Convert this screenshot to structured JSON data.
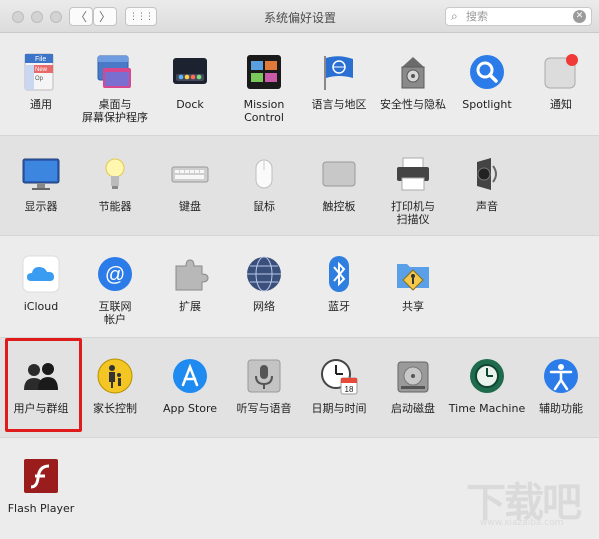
{
  "window": {
    "title": "系统偏好设置",
    "search_placeholder": "搜索",
    "grid_icon": "grid-icon",
    "back_icon": "chevron-left-icon",
    "forward_icon": "chevron-right-icon",
    "back_glyph": "〈",
    "forward_glyph": "〉",
    "grid_glyph": "⋮⋮⋮",
    "search_glyph": "⌕",
    "clear_glyph": "✕"
  },
  "rows": [
    [
      {
        "label": "通用",
        "icon": "general-icon"
      },
      {
        "label": "桌面与\n屏幕保护程序",
        "icon": "desktop-screensaver-icon"
      },
      {
        "label": "Dock",
        "icon": "dock-icon"
      },
      {
        "label": "Mission\nControl",
        "icon": "mission-control-icon"
      },
      {
        "label": "语言与地区",
        "icon": "language-region-icon"
      },
      {
        "label": "安全性与隐私",
        "icon": "security-privacy-icon"
      },
      {
        "label": "Spotlight",
        "icon": "spotlight-icon"
      },
      {
        "label": "通知",
        "icon": "notifications-icon"
      }
    ],
    [
      {
        "label": "显示器",
        "icon": "displays-icon"
      },
      {
        "label": "节能器",
        "icon": "energy-saver-icon"
      },
      {
        "label": "键盘",
        "icon": "keyboard-icon"
      },
      {
        "label": "鼠标",
        "icon": "mouse-icon"
      },
      {
        "label": "触控板",
        "icon": "trackpad-icon"
      },
      {
        "label": "打印机与\n扫描仪",
        "icon": "printers-scanners-icon"
      },
      {
        "label": "声音",
        "icon": "sound-icon"
      }
    ],
    [
      {
        "label": "iCloud",
        "icon": "icloud-icon"
      },
      {
        "label": "互联网\n帐户",
        "icon": "internet-accounts-icon"
      },
      {
        "label": "扩展",
        "icon": "extensions-icon"
      },
      {
        "label": "网络",
        "icon": "network-icon"
      },
      {
        "label": "蓝牙",
        "icon": "bluetooth-icon"
      },
      {
        "label": "共享",
        "icon": "sharing-icon"
      }
    ],
    [
      {
        "label": "用户与群组",
        "icon": "users-groups-icon"
      },
      {
        "label": "家长控制",
        "icon": "parental-controls-icon"
      },
      {
        "label": "App Store",
        "icon": "app-store-icon"
      },
      {
        "label": "听写与语音",
        "icon": "dictation-speech-icon"
      },
      {
        "label": "日期与时间",
        "icon": "date-time-icon"
      },
      {
        "label": "启动磁盘",
        "icon": "startup-disk-icon"
      },
      {
        "label": "Time Machine",
        "icon": "time-machine-icon"
      },
      {
        "label": "辅助功能",
        "icon": "accessibility-icon"
      }
    ],
    [
      {
        "label": "Flash Player",
        "icon": "flash-player-icon"
      }
    ]
  ],
  "general_icon_text": {
    "file": "File",
    "new": "New",
    "op": "Op"
  },
  "date_icon_text": {
    "day": "18"
  },
  "watermark": {
    "text": "下载吧",
    "url": "www.xiazaiba.com"
  },
  "colors": {
    "highlight": "#e01b1b",
    "accent_blue": "#1a7ff0"
  }
}
